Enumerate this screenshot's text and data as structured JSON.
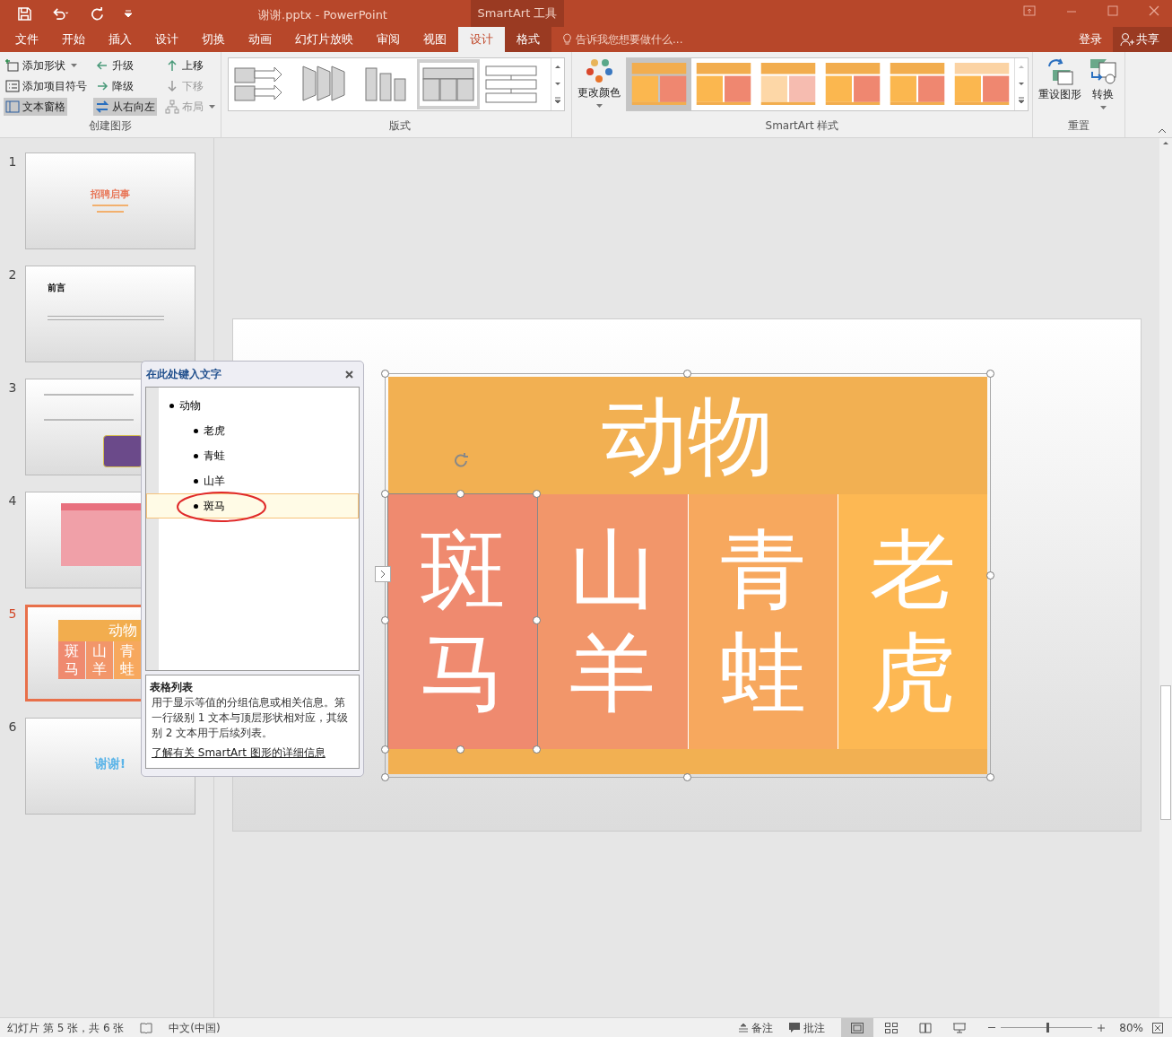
{
  "title_bar": {
    "title": "谢谢.pptx - PowerPoint",
    "context": "SmartArt 工具"
  },
  "tabs": [
    {
      "label": "文件",
      "selected": false
    },
    {
      "label": "开始",
      "selected": false
    },
    {
      "label": "插入",
      "selected": false
    },
    {
      "label": "设计",
      "selected": false
    },
    {
      "label": "切换",
      "selected": false
    },
    {
      "label": "动画",
      "selected": false
    },
    {
      "label": "幻灯片放映",
      "selected": false
    },
    {
      "label": "审阅",
      "selected": false
    },
    {
      "label": "视图",
      "selected": false
    },
    {
      "label": "设计",
      "selected": true
    },
    {
      "label": "格式",
      "selected": false
    }
  ],
  "tell_me": {
    "placeholder": "告诉我您想要做什么..."
  },
  "sign_in": "登录",
  "share": "共享",
  "ribbon": {
    "create_group": {
      "label": "创建图形",
      "buttons": [
        {
          "label": "添加形状",
          "disabled": false,
          "selected": false,
          "dropdown": true
        },
        {
          "label": "升级",
          "disabled": false,
          "selected": false,
          "dropdown": false
        },
        {
          "label": "上移",
          "disabled": false,
          "selected": false,
          "dropdown": false
        },
        {
          "label": "添加项目符号",
          "disabled": false,
          "selected": false,
          "dropdown": false
        },
        {
          "label": "降级",
          "disabled": false,
          "selected": false,
          "dropdown": false
        },
        {
          "label": "下移",
          "disabled": true,
          "selected": false,
          "dropdown": false
        },
        {
          "label": "文本窗格",
          "disabled": false,
          "selected": true,
          "dropdown": false
        },
        {
          "label": "从右向左",
          "disabled": false,
          "selected": true,
          "dropdown": false
        },
        {
          "label": "布局",
          "disabled": true,
          "selected": false,
          "dropdown": true
        }
      ]
    },
    "layouts": {
      "label": "版式",
      "items": [
        {
          "selected": false
        },
        {
          "selected": false
        },
        {
          "selected": false
        },
        {
          "selected": true
        },
        {
          "selected": false
        }
      ]
    },
    "change_colors": "更改颜色",
    "styles": {
      "label": "SmartArt 样式",
      "items": [
        {
          "selected": true
        },
        {
          "selected": false
        },
        {
          "selected": false
        },
        {
          "selected": false
        },
        {
          "selected": false
        },
        {
          "selected": false
        }
      ]
    },
    "reset_group": {
      "label": "重置",
      "buttons": [
        "重设图形",
        "转换"
      ]
    }
  },
  "slides": [
    {
      "number": "1",
      "selected": false,
      "title": "招聘启事"
    },
    {
      "number": "2",
      "selected": false,
      "title": "前言"
    },
    {
      "number": "3",
      "selected": false
    },
    {
      "number": "4",
      "selected": false
    },
    {
      "number": "5",
      "selected": true,
      "title": "动物",
      "cells": [
        "斑马",
        "山羊",
        "青蛙"
      ]
    },
    {
      "number": "6",
      "selected": false,
      "title": "谢谢!"
    }
  ],
  "text_pane": {
    "title": "在此处键入文字",
    "items": [
      {
        "text": "动物",
        "selected": false,
        "children": [
          {
            "text": "老虎",
            "selected": false
          },
          {
            "text": "青蛙",
            "selected": false
          },
          {
            "text": "山羊",
            "selected": false
          },
          {
            "text": "斑马",
            "selected": true
          }
        ]
      }
    ],
    "info_title": "表格列表",
    "info_text": "用于显示等值的分组信息或相关信息。第一行级别 1 文本与顶层形状相对应，其级别 2 文本用于后续列表。",
    "link": "了解有关 SmartArt 图形的详细信息"
  },
  "smartart": {
    "title": "动物",
    "cells": [
      {
        "text": "斑马",
        "color": "#ef8a6f",
        "selected": true
      },
      {
        "text": "山羊",
        "color": "#f2966a",
        "selected": false
      },
      {
        "text": "青蛙",
        "color": "#f7a85e",
        "selected": false
      },
      {
        "text": "老虎",
        "color": "#fdb853",
        "selected": false
      }
    ]
  },
  "status_bar": {
    "slide_info": "幻灯片 第 5 张，共 6 张",
    "language": "中文(中国)",
    "notes": "备注",
    "comments": "批注",
    "zoom": "80%",
    "zoom_slider": {
      "level": 0.5
    }
  }
}
